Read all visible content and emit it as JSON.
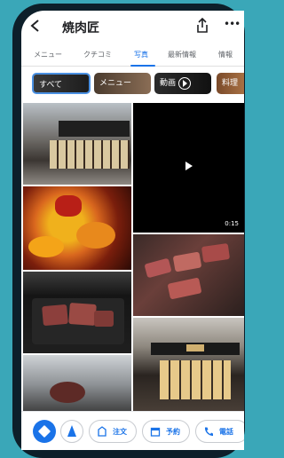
{
  "header": {
    "title": "焼肉匠"
  },
  "tabs": [
    {
      "label": "メニュー"
    },
    {
      "label": "クチコミ"
    },
    {
      "label": "写真",
      "active": true
    },
    {
      "label": "最新情報"
    },
    {
      "label": "情報"
    }
  ],
  "chips": [
    {
      "label": "すべて",
      "selected": true
    },
    {
      "label": "メニュー"
    },
    {
      "label": "動画"
    },
    {
      "label": "料理"
    }
  ],
  "video": {
    "duration": "0:15"
  },
  "actions": [
    {
      "label": "注文",
      "icon": "bag-icon"
    },
    {
      "label": "予約",
      "icon": "calendar-icon"
    },
    {
      "label": "電話",
      "icon": "phone-icon"
    }
  ],
  "colors": {
    "accent": "#1a73e8",
    "background": "#3aa7b8"
  }
}
